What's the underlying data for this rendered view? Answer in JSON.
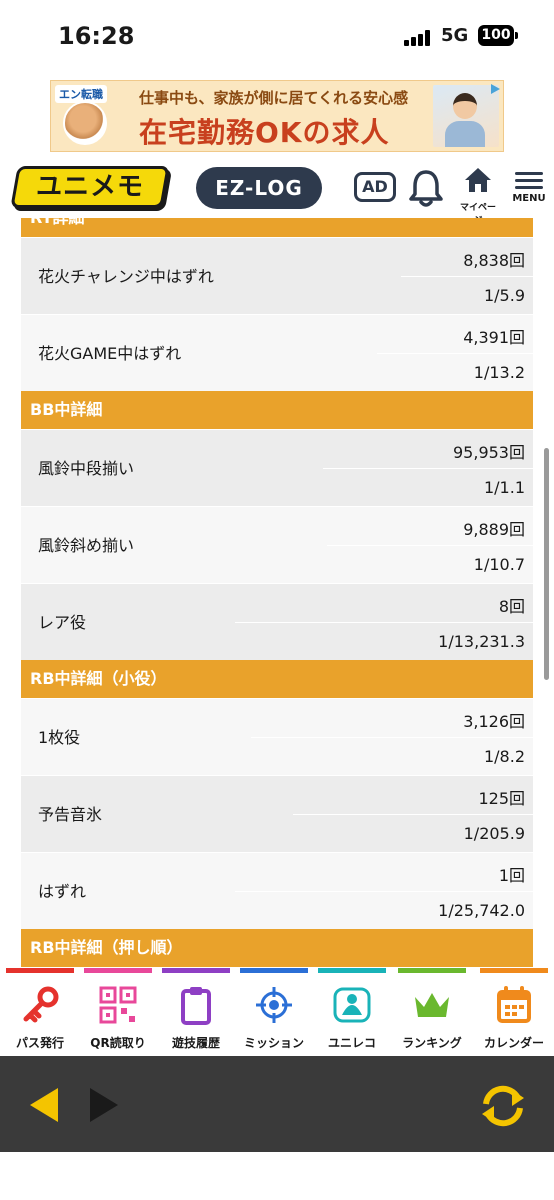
{
  "status_bar": {
    "time": "16:28",
    "network": "5G",
    "battery": "100"
  },
  "ad_banner": {
    "brand": "エン転職",
    "line1": "仕事中も、家族が側に居てくれる安心感",
    "line2": "在宅勤務OKの求人"
  },
  "header": {
    "logo_text": "ユニメモ",
    "ezlog_label": "EZ-LOG",
    "ad_label": "AD",
    "mypage_label": "マイページ",
    "menu_label": "MENU"
  },
  "sections": [
    {
      "title": "RT詳細",
      "rows": [
        {
          "label": "花火チャレンジ中はずれ",
          "count": "8,838回",
          "prob": "1/5.9"
        },
        {
          "label": "花火GAME中はずれ",
          "count": "4,391回",
          "prob": "1/13.2"
        }
      ]
    },
    {
      "title": "BB中詳細",
      "rows": [
        {
          "label": "風鈴中段揃い",
          "count": "95,953回",
          "prob": "1/1.1"
        },
        {
          "label": "風鈴斜め揃い",
          "count": "9,889回",
          "prob": "1/10.7"
        },
        {
          "label": "レア役",
          "count": "8回",
          "prob": "1/13,231.3"
        }
      ]
    },
    {
      "title": "RB中詳細（小役）",
      "rows": [
        {
          "label": "1枚役",
          "count": "3,126回",
          "prob": "1/8.2"
        },
        {
          "label": "予告音氷",
          "count": "125回",
          "prob": "1/205.9"
        },
        {
          "label": "はずれ",
          "count": "1回",
          "prob": "1/25,742.0"
        }
      ]
    },
    {
      "title": "RB中詳細（押し順）",
      "rows": []
    }
  ],
  "bottom_nav": [
    {
      "label": "パス発行",
      "icon": "key-icon",
      "color": "#e5322d"
    },
    {
      "label": "QR読取り",
      "icon": "qr-code-icon",
      "color": "#e8489a"
    },
    {
      "label": "遊技履歴",
      "icon": "clipboard-icon",
      "color": "#8e3fc4"
    },
    {
      "label": "ミッション",
      "icon": "target-icon",
      "color": "#2b6fd6"
    },
    {
      "label": "ユニレコ",
      "icon": "unireco-badge-icon",
      "color": "#19b3b8"
    },
    {
      "label": "ランキング",
      "icon": "crown-icon",
      "color": "#6ab82e"
    },
    {
      "label": "カレンダー",
      "icon": "calendar-icon",
      "color": "#f08a1c"
    }
  ]
}
